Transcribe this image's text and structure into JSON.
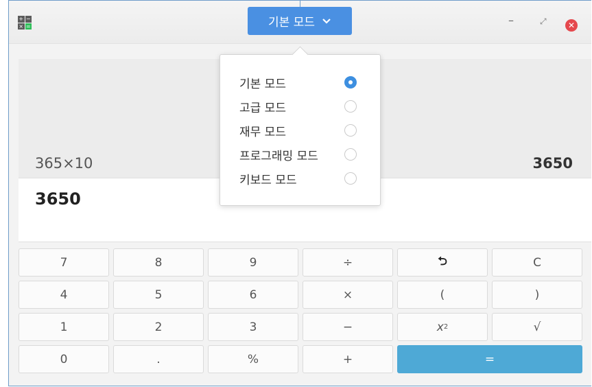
{
  "titlebar": {
    "mode_button_label": "기본 모드",
    "min_glyph": "–",
    "max_glyph": "⤢",
    "close_glyph": "✕",
    "icons": {
      "app": "calculator-icon",
      "chevron": "chevron-down-icon"
    }
  },
  "history": {
    "expression": "365×10",
    "result": "3650"
  },
  "display": {
    "value": "3650"
  },
  "keys": {
    "k7": "7",
    "k8": "8",
    "k9": "9",
    "div": "÷",
    "backspace": "⮌",
    "clear": "C",
    "k4": "4",
    "k5": "5",
    "k6": "6",
    "mul": "×",
    "lparen": "(",
    "rparen": ")",
    "k1": "1",
    "k2": "2",
    "k3": "3",
    "minus": "−",
    "square_base": "x",
    "square_exp": "2",
    "sqrt": "√",
    "k0": "0",
    "dot": ".",
    "percent": "%",
    "plus": "+",
    "equals": "="
  },
  "mode_menu": {
    "items": [
      {
        "label": "기본 모드",
        "selected": true
      },
      {
        "label": "고급 모드",
        "selected": false
      },
      {
        "label": "재무 모드",
        "selected": false
      },
      {
        "label": "프로그래밍 모드",
        "selected": false
      },
      {
        "label": "키보드 모드",
        "selected": false
      }
    ]
  },
  "colors": {
    "accent": "#4a90e2",
    "equals": "#4ea9d6",
    "close": "#e5484d"
  }
}
